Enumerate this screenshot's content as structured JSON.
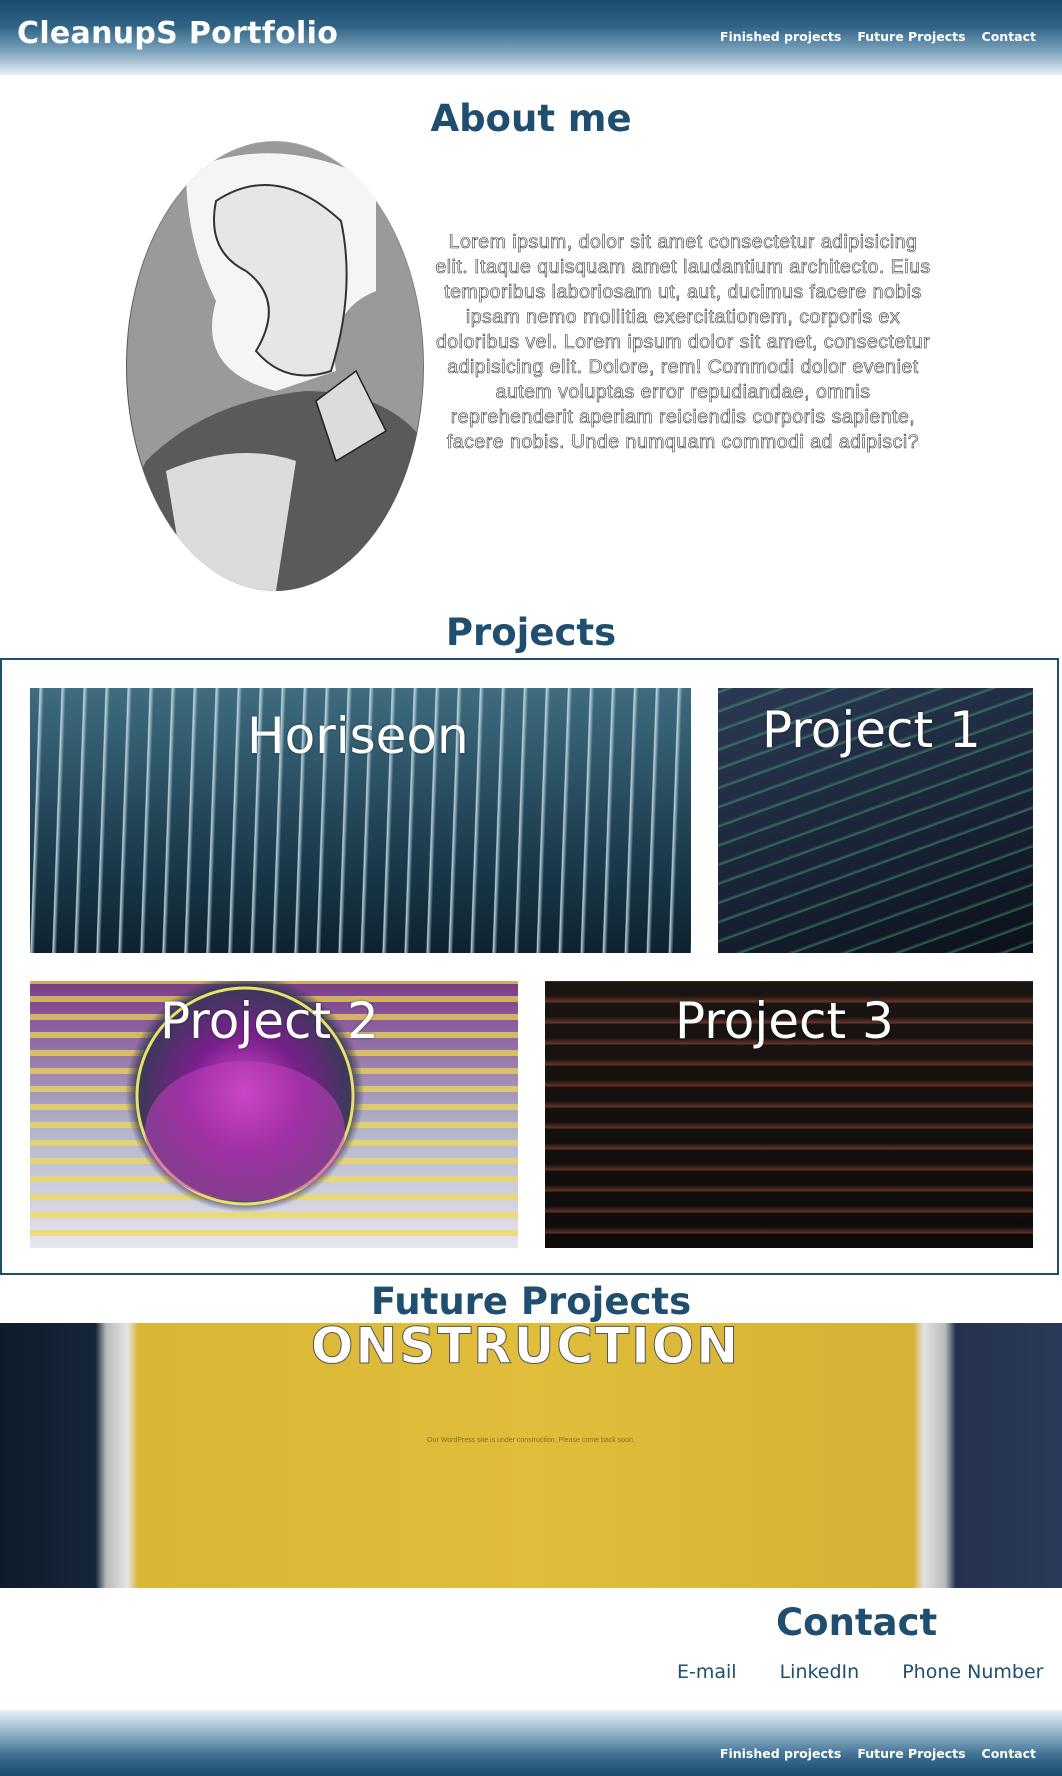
{
  "header": {
    "brand": "CleanupS Portfolio",
    "nav": [
      "Finished projects",
      "Future Projects",
      "Contact"
    ]
  },
  "about": {
    "title": "About me",
    "text": "Lorem ipsum, dolor sit amet consectetur adipisicing elit. Itaque quisquam amet laudantium architecto. Eius temporibus laboriosam ut, aut, ducimus facere nobis ipsam nemo mollitia exercitationem, corporis ex doloribus vel. Lorem ipsum dolor sit amet, consectetur adipisicing elit. Dolore, rem! Commodi dolor eveniet autem voluptas error repudiandae, omnis reprehenderit aperiam reiciendis corporis sapiente, facere nobis. Unde numquam commodi ad adipisci?"
  },
  "projects": {
    "title": "Projects",
    "cards": [
      {
        "label": "Horiseon"
      },
      {
        "label": "Project 1"
      },
      {
        "label": "Project 2"
      },
      {
        "label": "Project 3"
      }
    ]
  },
  "future": {
    "title": "Future Projects",
    "banner": "ONSTRUCTION",
    "note": "Our WordPress site is under construction. Please come back soon."
  },
  "contact": {
    "title": "Contact",
    "links": [
      "E-mail",
      "LinkedIn",
      "Phone Number"
    ]
  },
  "footer": {
    "nav": [
      "Finished projects",
      "Future Projects",
      "Contact"
    ]
  },
  "colors": {
    "accent": "#1f4e6e",
    "header_dark": "#1b4a6c"
  }
}
